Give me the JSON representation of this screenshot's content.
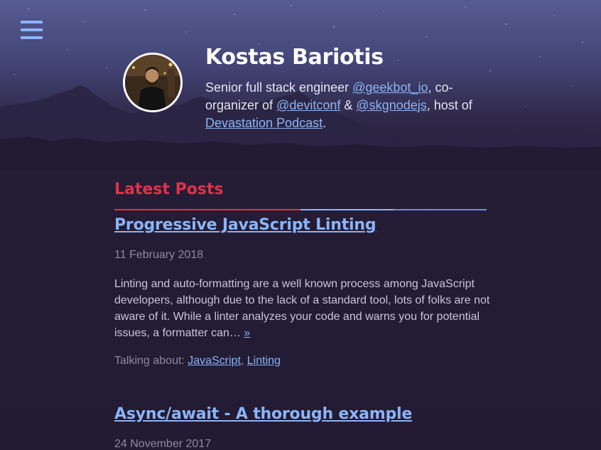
{
  "header": {
    "title": "Kostas Bariotis",
    "bio": {
      "part1": "Senior full stack engineer ",
      "link1": "@geekbot_io",
      "part2": ", co-organizer of ",
      "link2": "@devitconf",
      "part3": " & ",
      "link3": "@skgnodejs",
      "part4": ", host of ",
      "link4": "Devastation Podcast",
      "part5": "."
    }
  },
  "nav": {
    "menu_icon": "hamburger-menu-icon"
  },
  "latest_posts": {
    "heading": "Latest Posts",
    "posts": [
      {
        "title": "Progressive JavaScript Linting",
        "date": "11 February 2018",
        "excerpt": "Linting and auto-formatting are a well known process among JavaScript developers, although due to the lack of a standard tool, lots of folks are not aware of it. While a linter analyzes your code and warns you for potential issues, a formatter can…",
        "more": "»",
        "tags_label": "Talking about: ",
        "tags": [
          "JavaScript",
          "Linting"
        ],
        "tag_separator": ", "
      },
      {
        "title": "Async/await - A thorough example",
        "date": "24 November 2017"
      }
    ]
  },
  "colors": {
    "accent": "#e0324b",
    "link": "#8ab4f8",
    "background": "#231c34",
    "divider": [
      "#e0324b",
      "#8ab4f8",
      "#5d7ad6",
      "#6a8be8"
    ]
  }
}
